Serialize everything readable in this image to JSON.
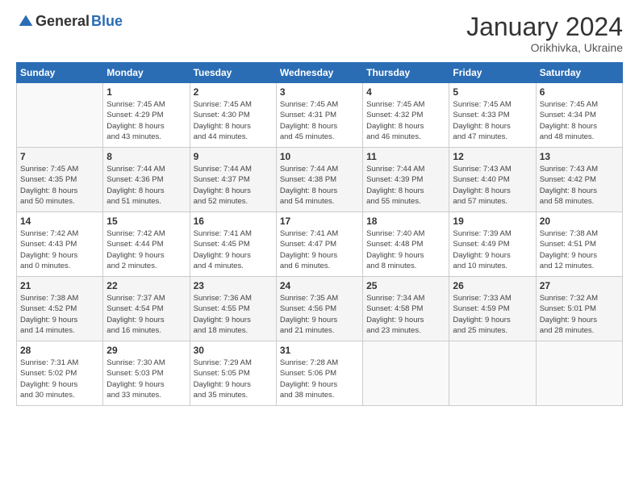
{
  "header": {
    "logo_general": "General",
    "logo_blue": "Blue",
    "month_title": "January 2024",
    "subtitle": "Orikhivka, Ukraine"
  },
  "calendar": {
    "headers": [
      "Sunday",
      "Monday",
      "Tuesday",
      "Wednesday",
      "Thursday",
      "Friday",
      "Saturday"
    ],
    "weeks": [
      [
        {
          "day": "",
          "info": ""
        },
        {
          "day": "1",
          "info": "Sunrise: 7:45 AM\nSunset: 4:29 PM\nDaylight: 8 hours\nand 43 minutes."
        },
        {
          "day": "2",
          "info": "Sunrise: 7:45 AM\nSunset: 4:30 PM\nDaylight: 8 hours\nand 44 minutes."
        },
        {
          "day": "3",
          "info": "Sunrise: 7:45 AM\nSunset: 4:31 PM\nDaylight: 8 hours\nand 45 minutes."
        },
        {
          "day": "4",
          "info": "Sunrise: 7:45 AM\nSunset: 4:32 PM\nDaylight: 8 hours\nand 46 minutes."
        },
        {
          "day": "5",
          "info": "Sunrise: 7:45 AM\nSunset: 4:33 PM\nDaylight: 8 hours\nand 47 minutes."
        },
        {
          "day": "6",
          "info": "Sunrise: 7:45 AM\nSunset: 4:34 PM\nDaylight: 8 hours\nand 48 minutes."
        }
      ],
      [
        {
          "day": "7",
          "info": "Sunrise: 7:45 AM\nSunset: 4:35 PM\nDaylight: 8 hours\nand 50 minutes."
        },
        {
          "day": "8",
          "info": "Sunrise: 7:44 AM\nSunset: 4:36 PM\nDaylight: 8 hours\nand 51 minutes."
        },
        {
          "day": "9",
          "info": "Sunrise: 7:44 AM\nSunset: 4:37 PM\nDaylight: 8 hours\nand 52 minutes."
        },
        {
          "day": "10",
          "info": "Sunrise: 7:44 AM\nSunset: 4:38 PM\nDaylight: 8 hours\nand 54 minutes."
        },
        {
          "day": "11",
          "info": "Sunrise: 7:44 AM\nSunset: 4:39 PM\nDaylight: 8 hours\nand 55 minutes."
        },
        {
          "day": "12",
          "info": "Sunrise: 7:43 AM\nSunset: 4:40 PM\nDaylight: 8 hours\nand 57 minutes."
        },
        {
          "day": "13",
          "info": "Sunrise: 7:43 AM\nSunset: 4:42 PM\nDaylight: 8 hours\nand 58 minutes."
        }
      ],
      [
        {
          "day": "14",
          "info": "Sunrise: 7:42 AM\nSunset: 4:43 PM\nDaylight: 9 hours\nand 0 minutes."
        },
        {
          "day": "15",
          "info": "Sunrise: 7:42 AM\nSunset: 4:44 PM\nDaylight: 9 hours\nand 2 minutes."
        },
        {
          "day": "16",
          "info": "Sunrise: 7:41 AM\nSunset: 4:45 PM\nDaylight: 9 hours\nand 4 minutes."
        },
        {
          "day": "17",
          "info": "Sunrise: 7:41 AM\nSunset: 4:47 PM\nDaylight: 9 hours\nand 6 minutes."
        },
        {
          "day": "18",
          "info": "Sunrise: 7:40 AM\nSunset: 4:48 PM\nDaylight: 9 hours\nand 8 minutes."
        },
        {
          "day": "19",
          "info": "Sunrise: 7:39 AM\nSunset: 4:49 PM\nDaylight: 9 hours\nand 10 minutes."
        },
        {
          "day": "20",
          "info": "Sunrise: 7:38 AM\nSunset: 4:51 PM\nDaylight: 9 hours\nand 12 minutes."
        }
      ],
      [
        {
          "day": "21",
          "info": "Sunrise: 7:38 AM\nSunset: 4:52 PM\nDaylight: 9 hours\nand 14 minutes."
        },
        {
          "day": "22",
          "info": "Sunrise: 7:37 AM\nSunset: 4:54 PM\nDaylight: 9 hours\nand 16 minutes."
        },
        {
          "day": "23",
          "info": "Sunrise: 7:36 AM\nSunset: 4:55 PM\nDaylight: 9 hours\nand 18 minutes."
        },
        {
          "day": "24",
          "info": "Sunrise: 7:35 AM\nSunset: 4:56 PM\nDaylight: 9 hours\nand 21 minutes."
        },
        {
          "day": "25",
          "info": "Sunrise: 7:34 AM\nSunset: 4:58 PM\nDaylight: 9 hours\nand 23 minutes."
        },
        {
          "day": "26",
          "info": "Sunrise: 7:33 AM\nSunset: 4:59 PM\nDaylight: 9 hours\nand 25 minutes."
        },
        {
          "day": "27",
          "info": "Sunrise: 7:32 AM\nSunset: 5:01 PM\nDaylight: 9 hours\nand 28 minutes."
        }
      ],
      [
        {
          "day": "28",
          "info": "Sunrise: 7:31 AM\nSunset: 5:02 PM\nDaylight: 9 hours\nand 30 minutes."
        },
        {
          "day": "29",
          "info": "Sunrise: 7:30 AM\nSunset: 5:03 PM\nDaylight: 9 hours\nand 33 minutes."
        },
        {
          "day": "30",
          "info": "Sunrise: 7:29 AM\nSunset: 5:05 PM\nDaylight: 9 hours\nand 35 minutes."
        },
        {
          "day": "31",
          "info": "Sunrise: 7:28 AM\nSunset: 5:06 PM\nDaylight: 9 hours\nand 38 minutes."
        },
        {
          "day": "",
          "info": ""
        },
        {
          "day": "",
          "info": ""
        },
        {
          "day": "",
          "info": ""
        }
      ]
    ]
  }
}
